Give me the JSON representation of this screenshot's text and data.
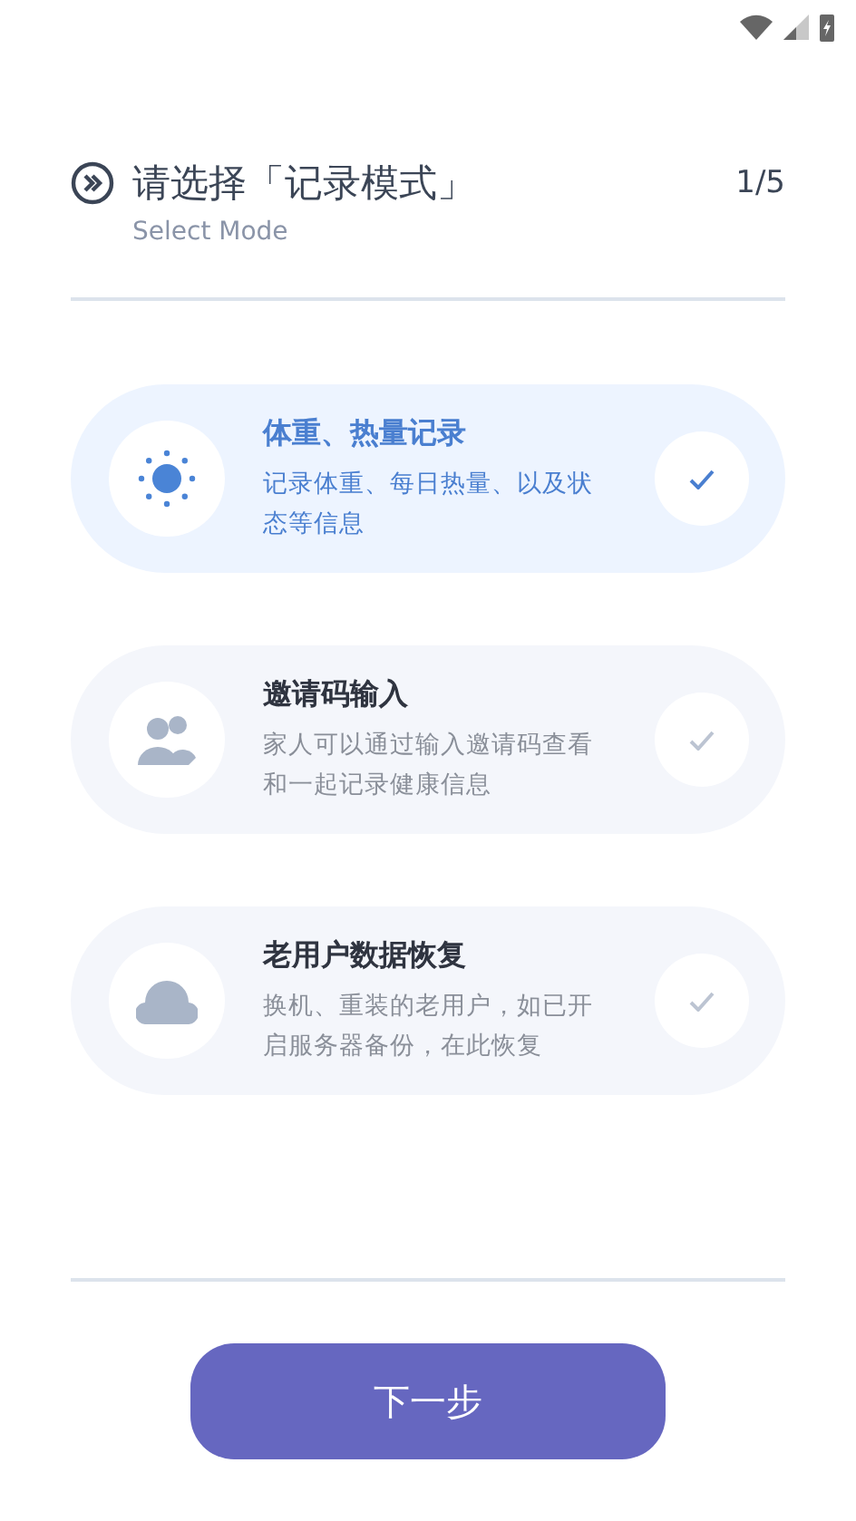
{
  "header": {
    "title": "请选择「记录模式」",
    "subtitle": "Select Mode",
    "step": "1/5"
  },
  "options": [
    {
      "kind": "sun",
      "title": "体重、热量记录",
      "description": "记录体重、每日热量、以及状态等信息",
      "selected": true
    },
    {
      "kind": "people",
      "title": "邀请码输入",
      "description": "家人可以通过输入邀请码查看和一起记录健康信息",
      "selected": false
    },
    {
      "kind": "cloud",
      "title": "老用户数据恢复",
      "description": "换机、重装的老用户，如已开启服务器备份，在此恢复",
      "selected": false
    }
  ],
  "next_button": "下一步"
}
